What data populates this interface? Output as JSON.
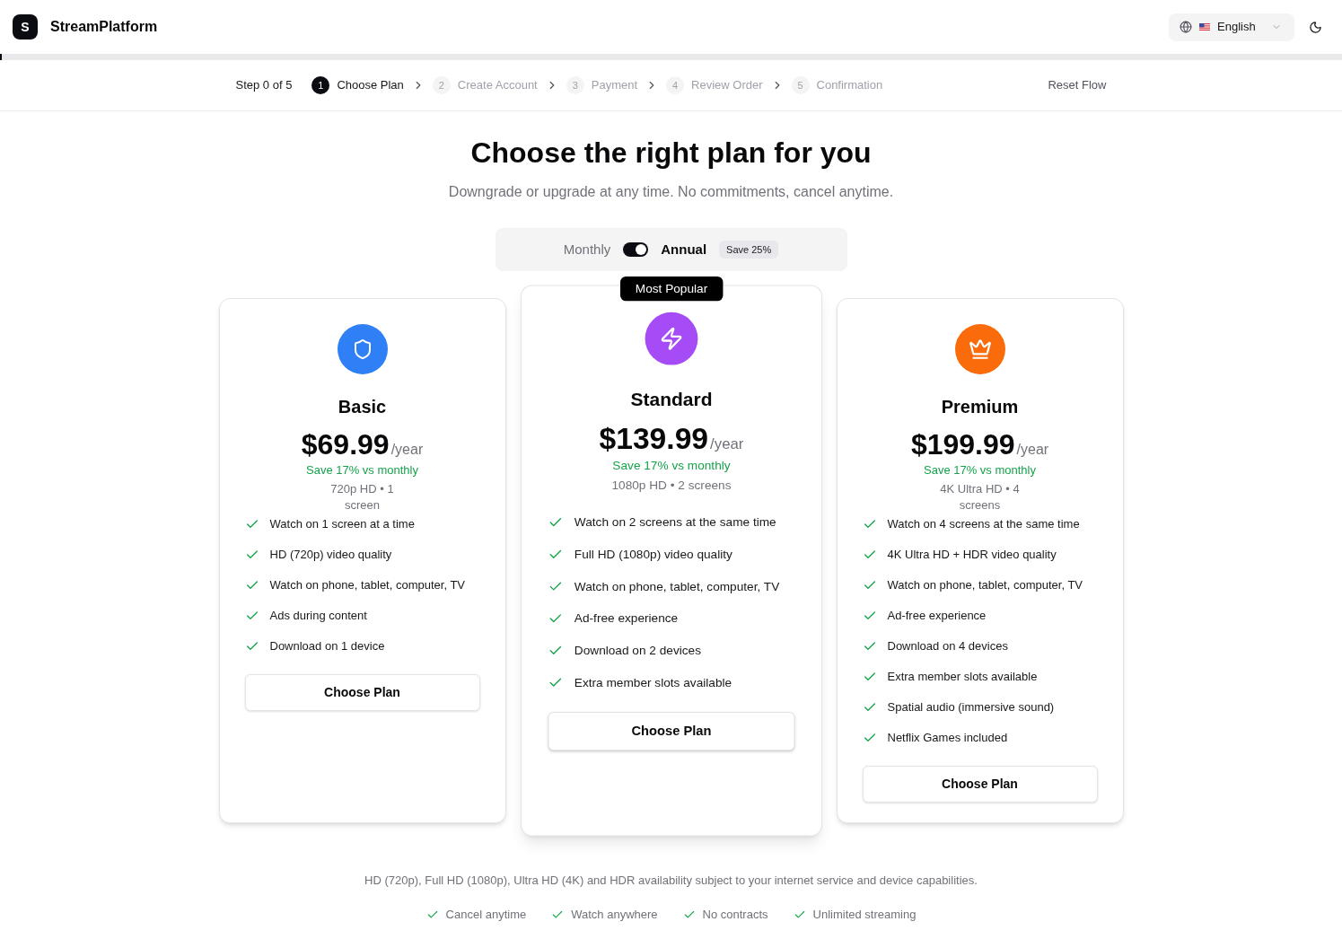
{
  "header": {
    "logo_letter": "S",
    "brand": "StreamPlatform",
    "language": "English",
    "progress": {
      "level": 0
    }
  },
  "stepper": {
    "counter": "Step 0 of 5",
    "steps": [
      {
        "number": "1",
        "label": "Choose Plan",
        "selected": true
      },
      {
        "number": "2",
        "label": "Create Account",
        "selected": false
      },
      {
        "number": "3",
        "label": "Payment",
        "selected": false
      },
      {
        "number": "4",
        "label": "Review Order",
        "selected": false
      },
      {
        "number": "5",
        "label": "Confirmation",
        "selected": false
      }
    ],
    "reset": "Reset Flow"
  },
  "hero": {
    "title": "Choose the right plan for you",
    "subtitle": "Downgrade or upgrade at any time. No commitments, cancel anytime."
  },
  "billing": {
    "monthly_label": "Monthly",
    "annual_label": "Annual",
    "switch_on": true,
    "badge": "Save 25%"
  },
  "plans": [
    {
      "name": "Basic",
      "color": "#2f7ff6",
      "popular": false,
      "price": "$69.99",
      "period": "/year",
      "savings": "Save 17% vs monthly",
      "spec": "720p HD • 1 screen",
      "features": [
        "Watch on 1 screen at a time",
        "HD (720p) video quality",
        "Watch on phone, tablet, computer, TV",
        "Ads during content",
        "Download on 1 device"
      ],
      "button": "Choose Plan"
    },
    {
      "name": "Standard",
      "color": "#a54cf6",
      "popular": true,
      "badge": "Most Popular",
      "price": "$139.99",
      "period": "/year",
      "savings": "Save 17% vs monthly",
      "spec": "1080p HD • 2 screens",
      "features": [
        "Watch on 2 screens at the same time",
        "Full HD (1080p) video quality",
        "Watch on phone, tablet, computer, TV",
        "Ad-free experience",
        "Download on 2 devices",
        "Extra member slots available"
      ],
      "button": "Choose Plan"
    },
    {
      "name": "Premium",
      "color": "#fa6b0b",
      "popular": false,
      "price": "$199.99",
      "period": "/year",
      "savings": "Save 17% vs monthly",
      "spec": "4K Ultra HD • 4 screens",
      "features": [
        "Watch on 4 screens at the same time",
        "4K Ultra HD + HDR video quality",
        "Watch on phone, tablet, computer, TV",
        "Ad-free experience",
        "Download on 4 devices",
        "Extra member slots available",
        "Spatial audio (immersive sound)",
        "Netflix Games included"
      ],
      "button": "Choose Plan"
    }
  ],
  "footer": {
    "note": "HD (720p), Full HD (1080p), Ultra HD (4K) and HDR availability subject to your internet service and device capabilities.",
    "perks": [
      "Cancel anytime",
      "Watch anywhere",
      "No contracts",
      "Unlimited streaming"
    ]
  }
}
